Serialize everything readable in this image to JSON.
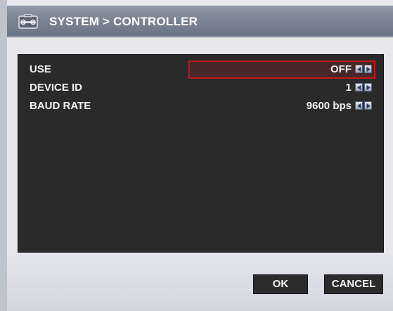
{
  "window": {
    "title": "SYSTEM > CONTROLLER",
    "title_icon": "wrench-icon"
  },
  "settings": [
    {
      "label": "USE",
      "value": "OFF",
      "focused": true
    },
    {
      "label": "DEVICE ID",
      "value": "1",
      "focused": false
    },
    {
      "label": "BAUD RATE",
      "value": "9600 bps",
      "focused": false
    }
  ],
  "icons": {
    "decrease": "left-arrow-icon",
    "increase": "right-arrow-icon"
  },
  "buttons": {
    "ok": "OK",
    "cancel": "CANCEL"
  },
  "colors": {
    "panel_bg": "#2a2a2b",
    "focus_border": "#c41818",
    "title_bar": "#7b8494"
  }
}
